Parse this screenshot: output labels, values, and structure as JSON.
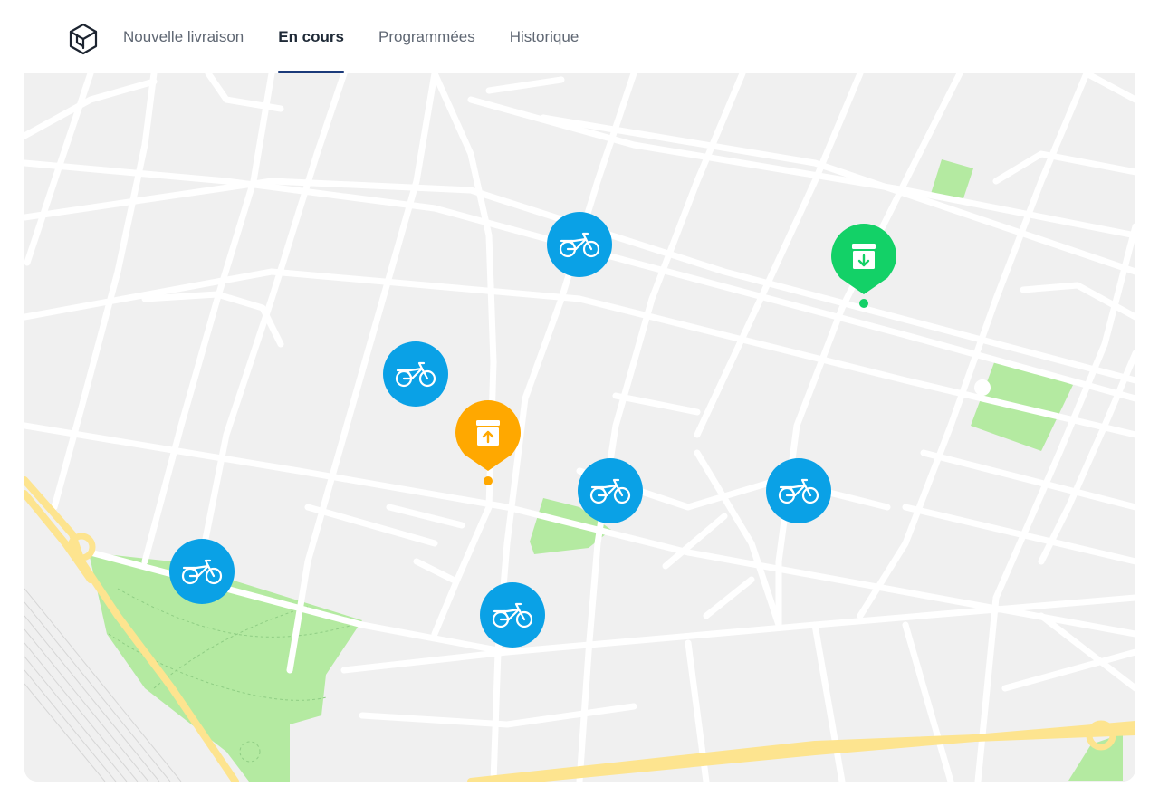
{
  "nav": {
    "logo_icon": "box-logo-icon",
    "tabs": [
      {
        "label": "Nouvelle livraison",
        "active": false
      },
      {
        "label": "En cours",
        "active": true
      },
      {
        "label": "Programmées",
        "active": false
      },
      {
        "label": "Historique",
        "active": false
      }
    ]
  },
  "map": {
    "colors": {
      "background": "#f0f0f0",
      "road": "#ffffff",
      "highway": "#fde48f",
      "park": "#b4eaa1",
      "courier": "#0aa1e6",
      "pickup": "#ffa800",
      "dropoff": "#13d167"
    },
    "couriers": [
      {
        "icon": "bicycle-icon",
        "status": "en-route"
      },
      {
        "icon": "bicycle-icon",
        "status": "en-route"
      },
      {
        "icon": "bicycle-icon",
        "status": "en-route"
      },
      {
        "icon": "bicycle-icon",
        "status": "en-route"
      },
      {
        "icon": "bicycle-icon",
        "status": "en-route"
      },
      {
        "icon": "bicycle-icon",
        "status": "en-route"
      }
    ],
    "pickup": {
      "icon": "package-up-icon"
    },
    "dropoff": {
      "icon": "package-down-icon"
    }
  }
}
